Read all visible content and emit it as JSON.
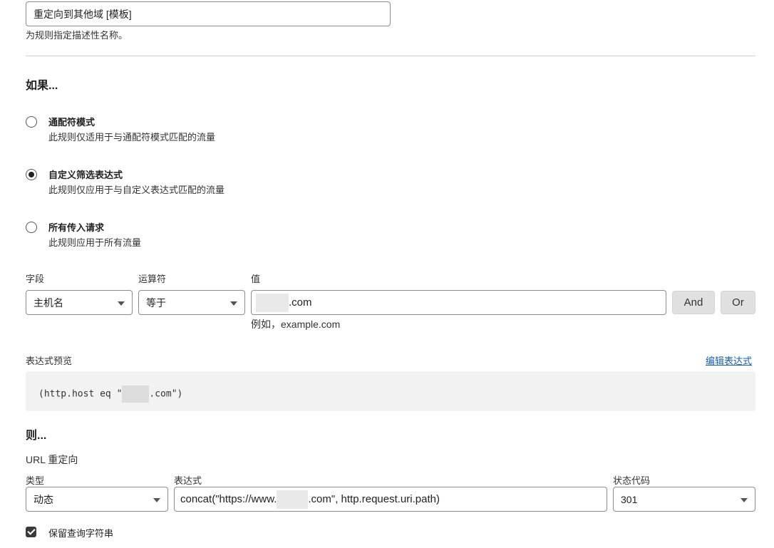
{
  "rule_name": {
    "value": "重定向到其他域 [模板]",
    "help": "为规则指定描述性名称。"
  },
  "if_section": {
    "heading": "如果...",
    "options": [
      {
        "title": "通配符模式",
        "desc": "此规则仅适用于与通配符模式匹配的流量",
        "selected": false
      },
      {
        "title": "自定义筛选表达式",
        "desc": "此规则仅应用于与自定义表达式匹配的流量",
        "selected": true
      },
      {
        "title": "所有传入请求",
        "desc": "此规则应用于所有流量",
        "selected": false
      }
    ]
  },
  "filter": {
    "field_label": "字段",
    "operator_label": "运算符",
    "value_label": "值",
    "field_value": "主机名",
    "operator_value": "等于",
    "value_suffix": ".com",
    "value_hint": "例如，example.com",
    "and_button": "And",
    "or_button": "Or"
  },
  "preview": {
    "label": "表达式预览",
    "edit_link": "编辑表达式",
    "expr_prefix": "(http.host eq \"",
    "expr_suffix": ".com\")"
  },
  "then_section": {
    "heading": "则...",
    "action": "URL 重定向",
    "type_label": "类型",
    "expr_label": "表达式",
    "status_label": "状态代码",
    "type_value": "动态",
    "expr_prefix": "concat(\"https://www.",
    "expr_suffix": ".com\", http.request.uri.path)",
    "status_value": "301",
    "preserve_query": "保留查询字符串",
    "preserve_checked": true
  }
}
